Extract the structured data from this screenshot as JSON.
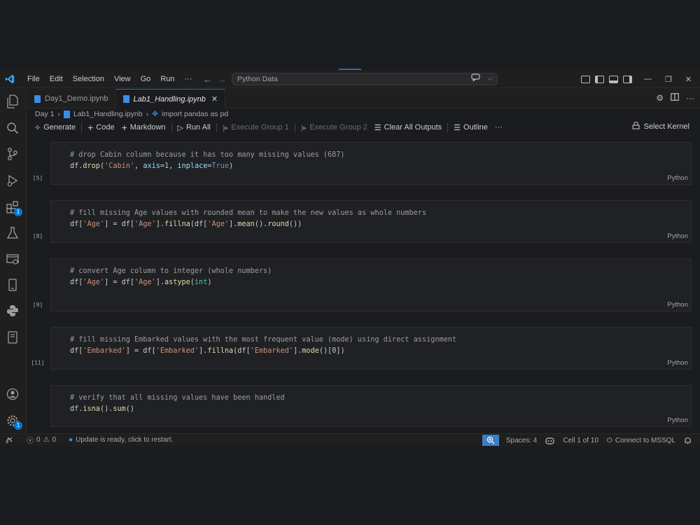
{
  "menu": [
    "File",
    "Edit",
    "Selection",
    "View",
    "Go",
    "Run",
    "···"
  ],
  "command_center": {
    "text": "Python Data"
  },
  "tabs": [
    {
      "label": "Day1_Demo.ipynb",
      "active": false
    },
    {
      "label": "Lab1_Handling.ipynb",
      "active": true
    }
  ],
  "breadcrumb": [
    "Day 1",
    "Lab1_Handling.ipynb",
    "import pandas as pd"
  ],
  "toolbar": {
    "generate": "Generate",
    "code": "Code",
    "markdown": "Markdown",
    "run_all": "Run All",
    "execute_group_1": "Execute Group 1",
    "execute_group_2": "Execute Group 2",
    "clear_all_outputs": "Clear All Outputs",
    "outline": "Outline",
    "more": "···",
    "select_kernel": "Select Kernel"
  },
  "activity_badges": {
    "extensions": "1",
    "settings": "1"
  },
  "cells": [
    {
      "count": "[5]",
      "language": "Python",
      "comment": "# drop Cabin column because it has too many missing values (687)"
    },
    {
      "count": "[8]",
      "language": "Python",
      "comment": "# fill missing Age values with rounded mean to make the new values as whole numbers"
    },
    {
      "count": "[9]",
      "language": "Python",
      "comment": "# convert Age column to integer (whole numbers)"
    },
    {
      "count": "[11]",
      "language": "Python",
      "comment": "# fill missing Embarked values with the most frequent value (mode) using direct assignment"
    },
    {
      "count": "",
      "language": "Python",
      "comment": "# verify that all missing values have been handled"
    }
  ],
  "statusbar": {
    "errors": "0",
    "warnings": "0",
    "update_msg": "Update is ready, click to restart.",
    "spaces": "Spaces: 4",
    "cell": "Cell 1 of 10",
    "connect": "Connect to MSSQL"
  },
  "colors": {
    "accent": "#0078d4",
    "background": "#1b1c1f",
    "cell_bg": "#202124"
  }
}
